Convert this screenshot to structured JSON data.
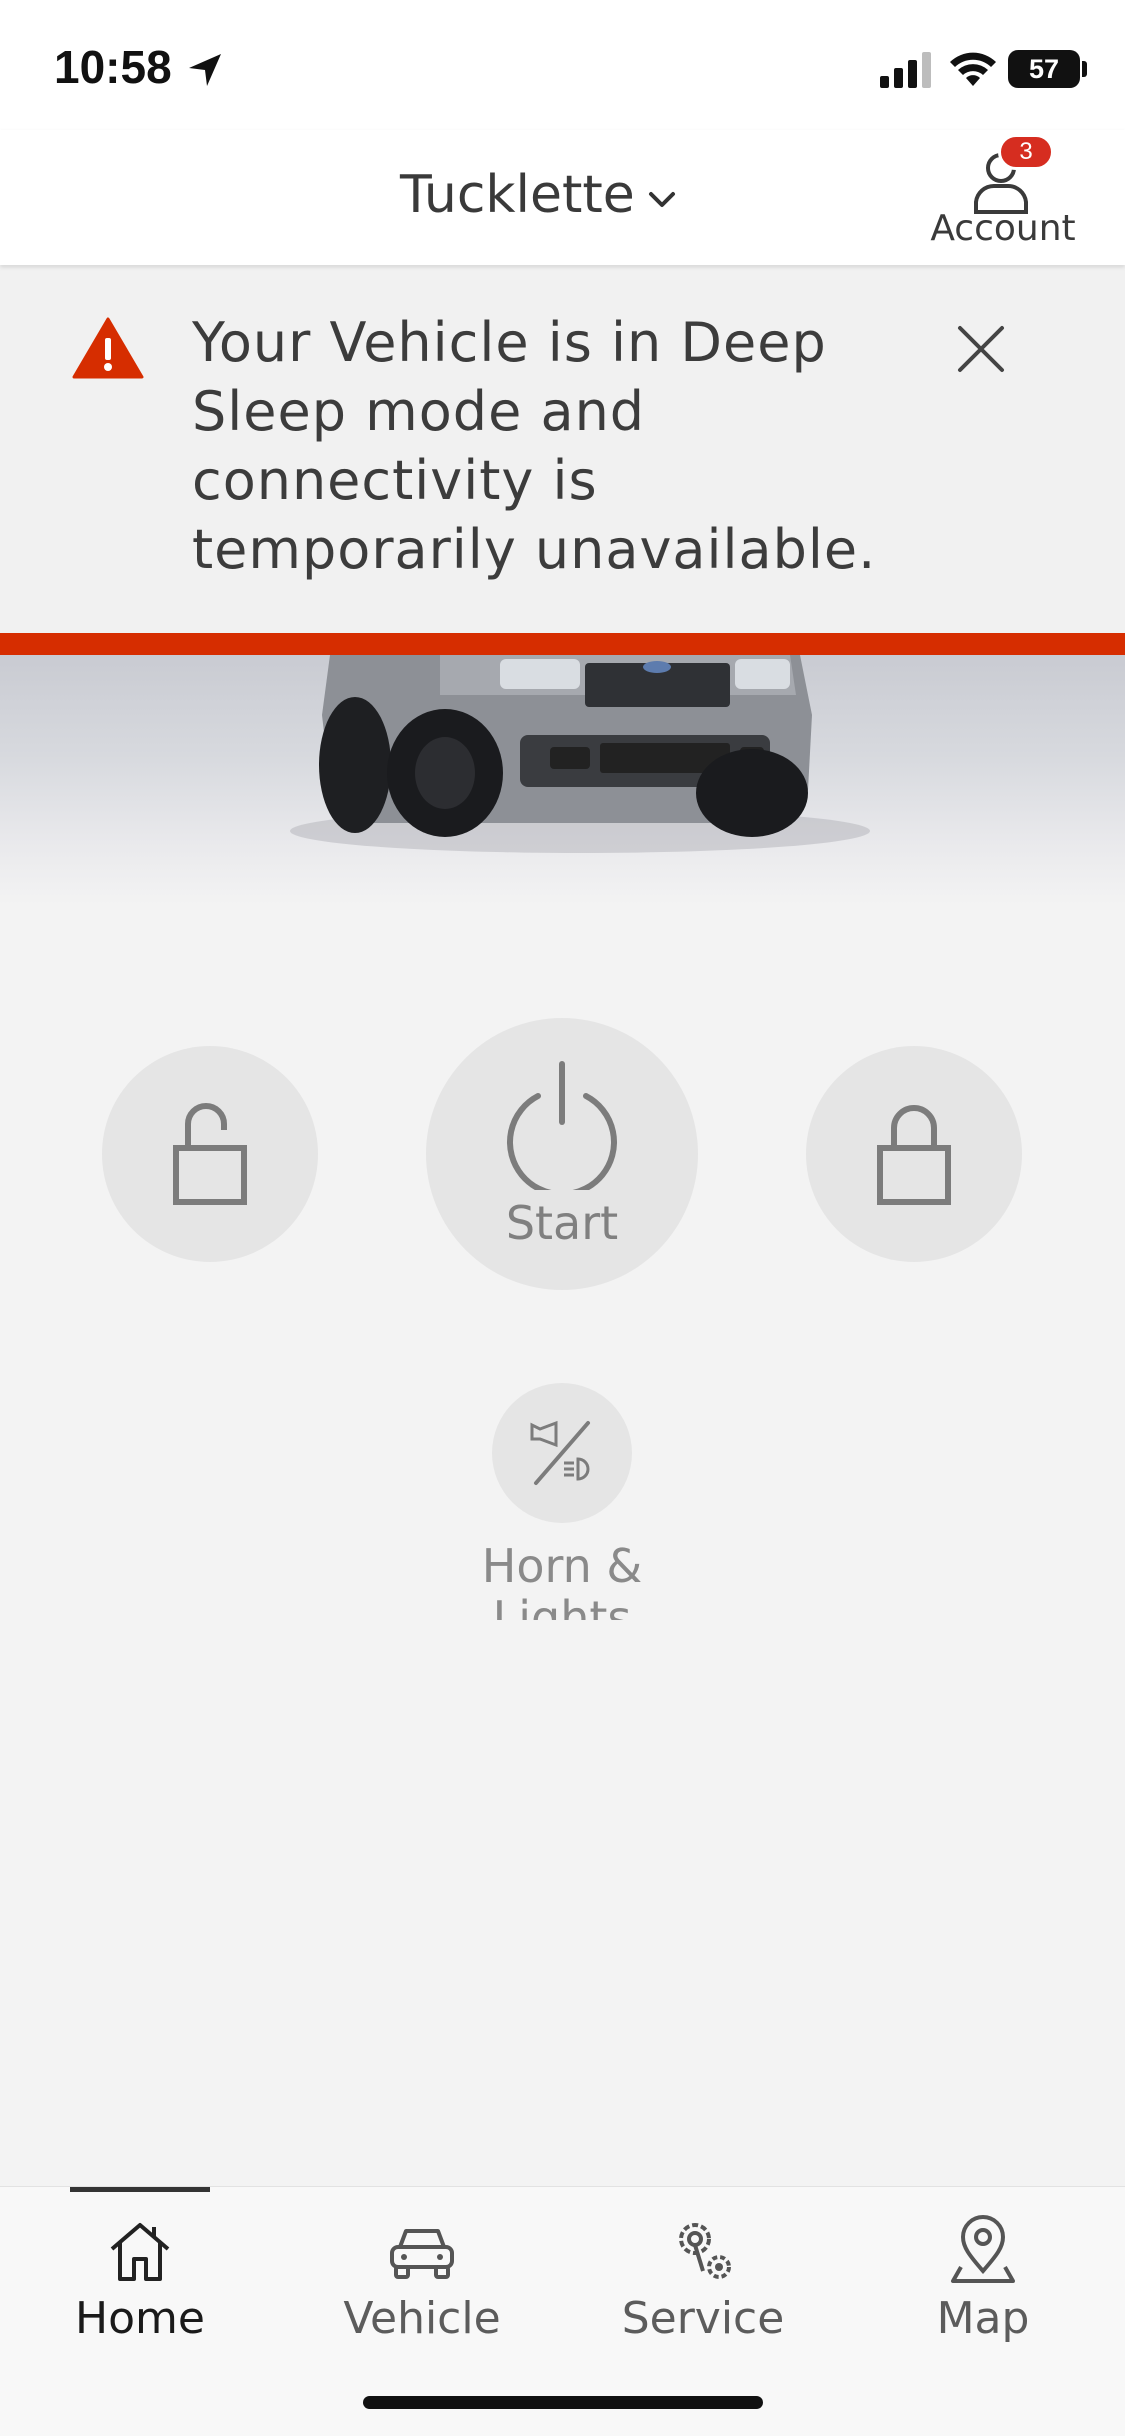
{
  "status_bar": {
    "time": "10:58",
    "battery": "57"
  },
  "header": {
    "vehicle_name": "Tucklette",
    "account_label": "Account",
    "account_badge": "3"
  },
  "alert": {
    "message": "Your Vehicle is in Deep Sleep mode and connectivity is temporarily unavailable.",
    "accent_color": "#d62d00"
  },
  "controls": {
    "start_label": "Start",
    "horn_lights_label": "Horn & Lights"
  },
  "bottom_nav": {
    "items": [
      {
        "label": "Home",
        "icon": "home-icon",
        "active": true
      },
      {
        "label": "Vehicle",
        "icon": "car-icon",
        "active": false
      },
      {
        "label": "Service",
        "icon": "service-gear-icon",
        "active": false
      },
      {
        "label": "Map",
        "icon": "map-pin-icon",
        "active": false
      }
    ]
  }
}
